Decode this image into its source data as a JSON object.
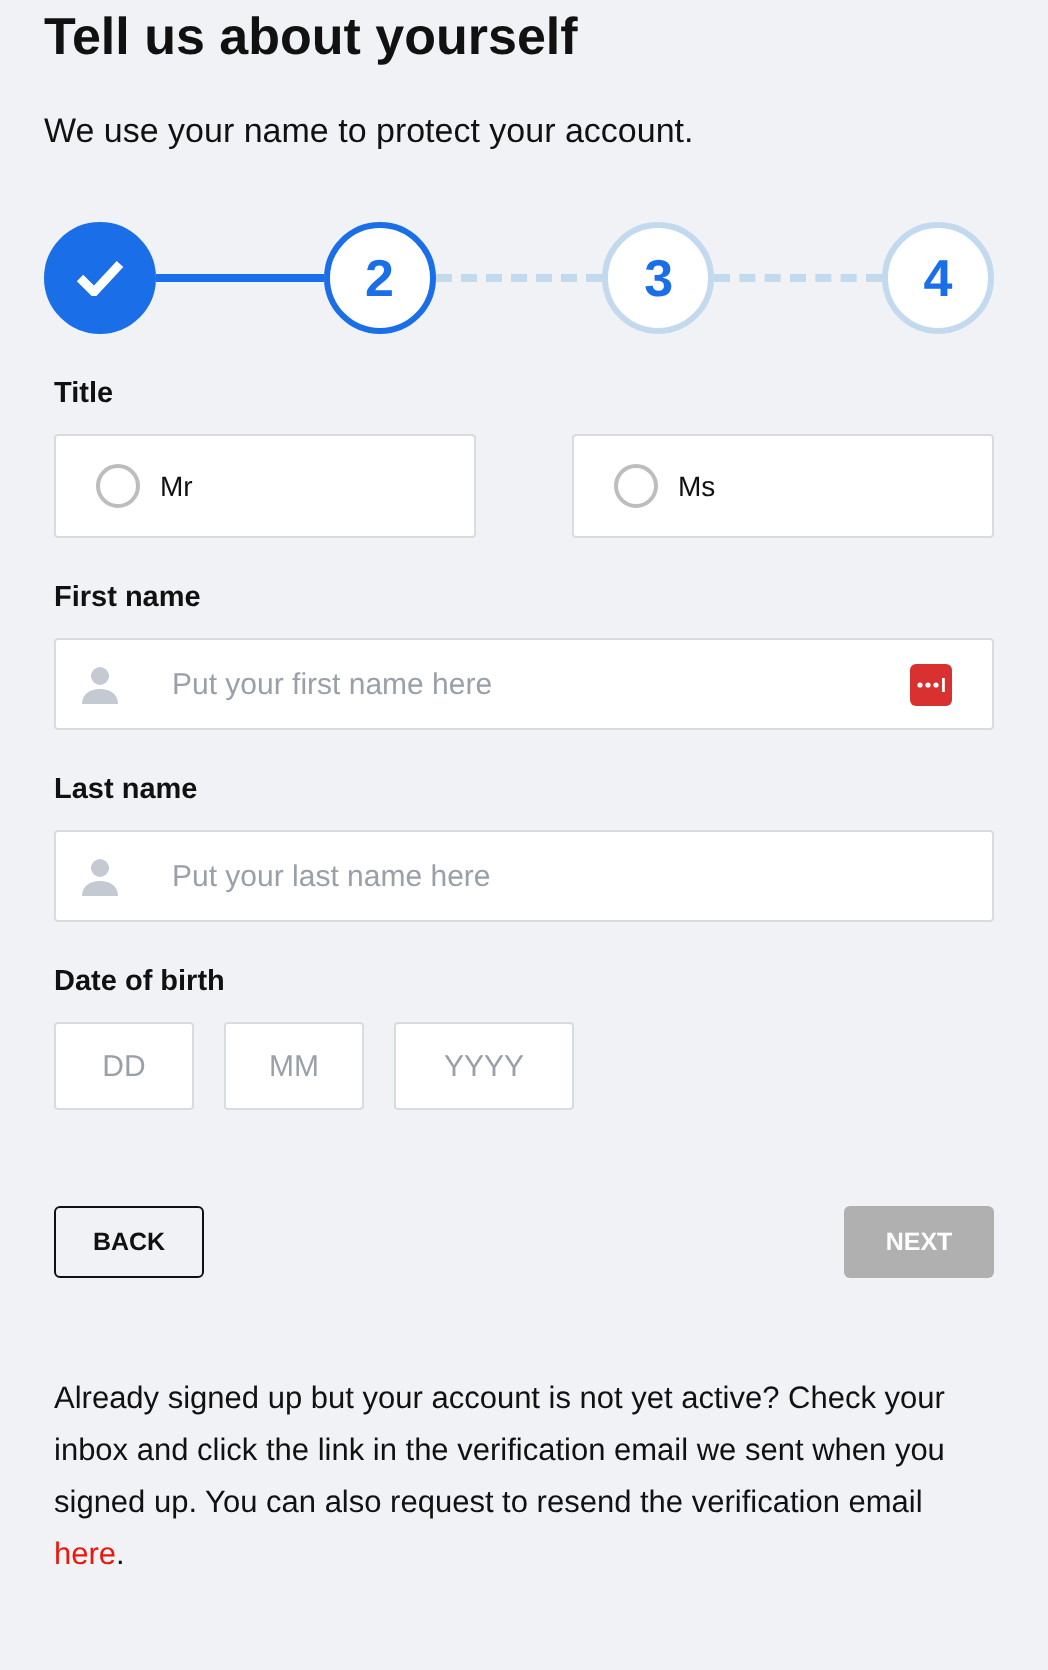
{
  "heading": "Tell us about yourself",
  "subtitle": "We use your name to protect your account.",
  "steps": [
    {
      "completed": true,
      "selected": false
    },
    {
      "label": "2",
      "completed": false,
      "selected": true
    },
    {
      "label": "3",
      "completed": false,
      "selected": false
    },
    {
      "label": "4",
      "completed": false,
      "selected": false
    }
  ],
  "title_field": {
    "label": "Title",
    "options": [
      {
        "label": "Mr",
        "selected": false
      },
      {
        "label": "Ms",
        "selected": false
      }
    ]
  },
  "first_name": {
    "label": "First name",
    "placeholder": "Put your first name here",
    "password_manager_icon": true
  },
  "last_name": {
    "label": "Last name",
    "placeholder": "Put your last name here"
  },
  "date_of_birth": {
    "label": "Date of birth",
    "fields": [
      {
        "placeholder": "DD"
      },
      {
        "placeholder": "MM"
      },
      {
        "placeholder": "YYYY"
      }
    ]
  },
  "buttons": [
    {
      "label": "BACK",
      "disabled": false
    },
    {
      "label": "NEXT",
      "disabled": true
    }
  ],
  "note": {
    "before": "Already signed up but your account is not yet active? Check your inbox and click the link in the verification email we sent when you signed up. You can also request to resend the verification email ",
    "link": "here",
    "after": "."
  }
}
